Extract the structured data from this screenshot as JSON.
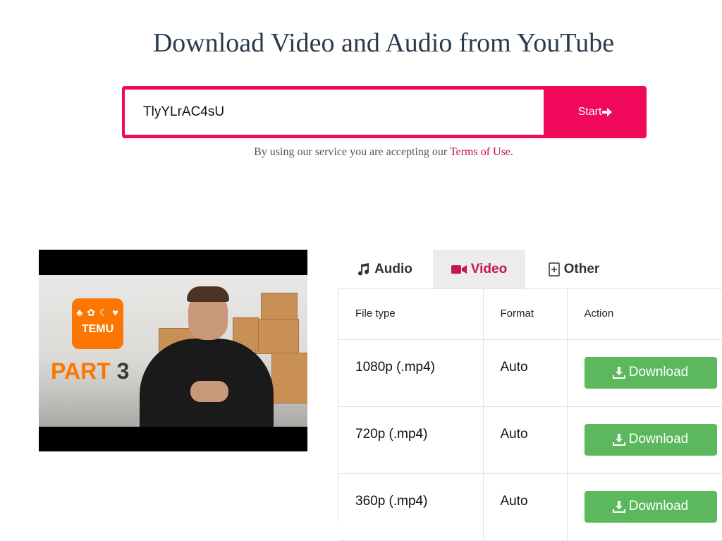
{
  "page_title": "Download Video and Audio from YouTube",
  "search": {
    "value": "TlyYLrAC4sU",
    "button_label": "Start"
  },
  "terms": {
    "prefix": "By using our service you are accepting our ",
    "link": "Terms of Use",
    "suffix": "."
  },
  "thumbnail": {
    "brand": "TEMU",
    "part_word": "PART",
    "part_number": "3"
  },
  "tabs": [
    {
      "label": "Audio",
      "icon": "music-note-icon",
      "active": false
    },
    {
      "label": "Video",
      "icon": "video-camera-icon",
      "active": true
    },
    {
      "label": "Other",
      "icon": "file-plus-icon",
      "active": false
    }
  ],
  "table": {
    "headers": [
      "File type",
      "Format",
      "Action"
    ],
    "rows": [
      {
        "file_type": "1080p (.mp4)",
        "format": "Auto",
        "action": "Download"
      },
      {
        "file_type": "720p (.mp4)",
        "format": "Auto",
        "action": "Download"
      },
      {
        "file_type": "360p (.mp4)",
        "format": "Auto",
        "action": "Download"
      }
    ]
  },
  "colors": {
    "accent": "#f0085a",
    "active_tab_text": "#c5154d",
    "download_button": "#5cb85c",
    "temu_orange": "#fb7701"
  }
}
